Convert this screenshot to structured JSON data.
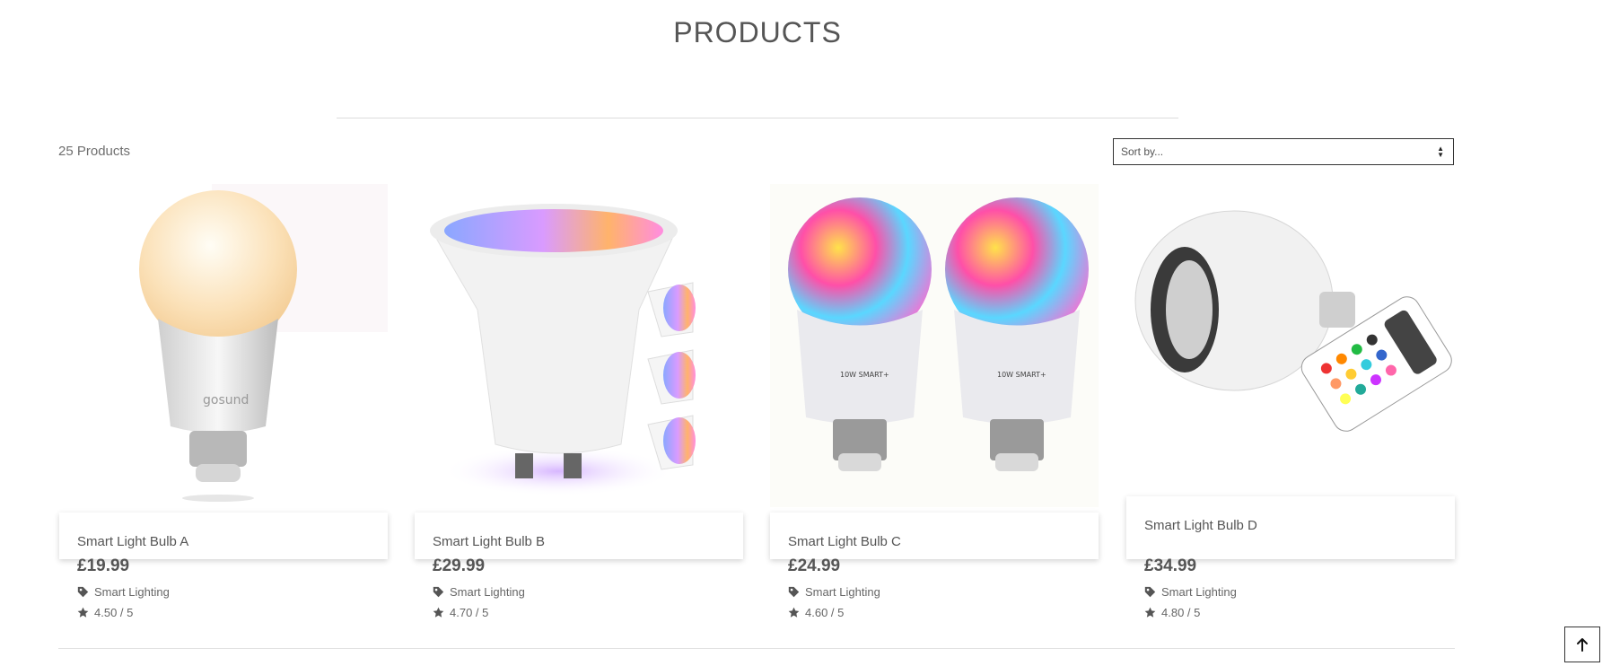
{
  "header": {
    "title": "PRODUCTS"
  },
  "toolbar": {
    "count_label": "25 Products",
    "sort_placeholder": "Sort by..."
  },
  "products": [
    {
      "name": "Smart Light Bulb A",
      "price": "£19.99",
      "category": "Smart Lighting",
      "rating": "4.50 / 5"
    },
    {
      "name": "Smart Light Bulb B",
      "price": "£29.99",
      "category": "Smart Lighting",
      "rating": "4.70 / 5"
    },
    {
      "name": "Smart Light Bulb C",
      "price": "£24.99",
      "category": "Smart Lighting",
      "rating": "4.60 / 5"
    },
    {
      "name": "Smart Light Bulb D",
      "price": "£34.99",
      "category": "Smart Lighting",
      "rating": "4.80 / 5"
    }
  ],
  "icons": {
    "category": "tag-icon",
    "rating": "star-icon",
    "back_to_top": "arrow-up-icon",
    "sort": "sort-arrows-icon"
  }
}
